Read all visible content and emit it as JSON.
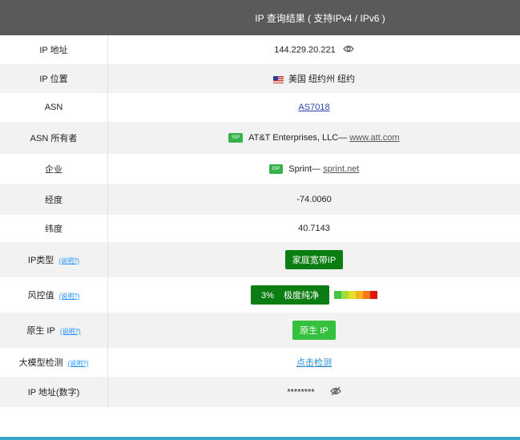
{
  "header": {
    "title": "IP 查询结果 ( 支持IPv4 / IPv6 )"
  },
  "rows": {
    "ip": {
      "label": "IP 地址",
      "value": "144.229.20.221",
      "icon": "eye-icon"
    },
    "location": {
      "label": "IP 位置",
      "flag": "us-flag-icon",
      "value": "美国 纽约州 纽约"
    },
    "asn": {
      "label": "ASN",
      "value": "AS7018"
    },
    "asn_owner": {
      "label": "ASN 所有者",
      "tag": "ISP",
      "name": "AT&T Enterprises, LLC—",
      "link": "www.att.com"
    },
    "company": {
      "label": "企业",
      "tag": "ISP",
      "name": "Sprint—",
      "link": "sprint.net"
    },
    "longitude": {
      "label": "经度",
      "value": "-74.0060"
    },
    "latitude": {
      "label": "纬度",
      "value": "40.7143"
    },
    "ip_type": {
      "label": "IP类型",
      "help": "(说明?)",
      "value": "家庭宽带IP"
    },
    "risk": {
      "label": "风控值",
      "help": "(说明?)",
      "percent": "3%",
      "text": "极度纯净",
      "scale_colors": [
        "#43c443",
        "#9edc3a",
        "#e3e02a",
        "#f5b21c",
        "#f07a1a",
        "#e21414"
      ]
    },
    "native": {
      "label": "原生 IP",
      "help": "(说明?)",
      "value": "原生 IP"
    },
    "llm": {
      "label": "大模型检测",
      "help": "(说明?)",
      "value": "点击检测"
    },
    "ip_num": {
      "label": "IP 地址(数字)",
      "value": "********",
      "icon": "eye-off-icon"
    }
  },
  "colors": {
    "header_bg": "#5a5a5a",
    "accent_dark_green": "#0c7d12",
    "accent_green": "#35c03d",
    "footer_line": "#3ba6c9"
  }
}
